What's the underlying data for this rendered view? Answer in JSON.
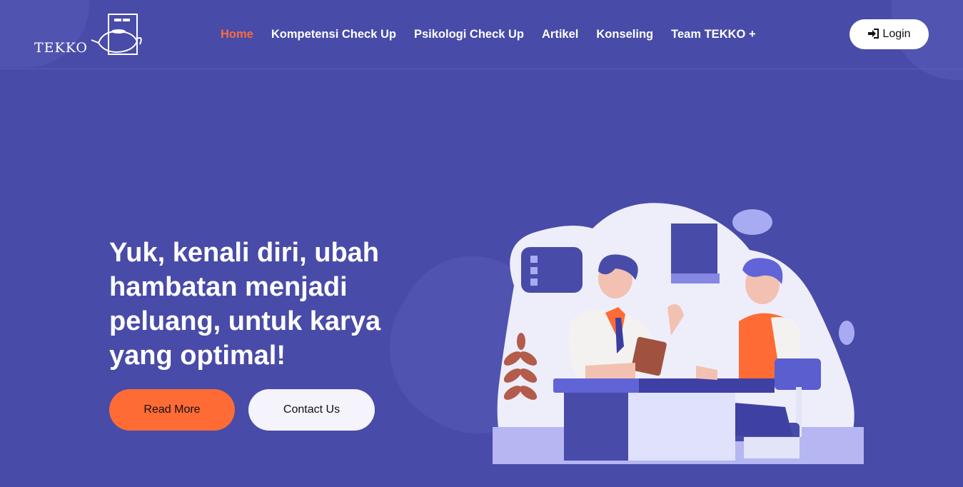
{
  "brand": {
    "name": "TEKKO"
  },
  "nav": {
    "items": [
      {
        "label": "Home",
        "active": true
      },
      {
        "label": "Kompetensi Check Up"
      },
      {
        "label": "Psikologi Check Up"
      },
      {
        "label": "Artikel"
      },
      {
        "label": "Konseling"
      },
      {
        "label": "Team TEKKO +"
      }
    ]
  },
  "header": {
    "login_label": "Login",
    "login_icon": "sign-in-icon"
  },
  "hero": {
    "title": "Yuk, kenali diri, ubah hambatan menjadi peluang, untuk karya yang optimal!",
    "read_more_label": "Read More",
    "contact_label": "Contact Us"
  },
  "colors": {
    "background": "#484ba8",
    "accent": "#ff6b35",
    "nav_active": "#ff6b3d",
    "white": "#ffffff"
  }
}
